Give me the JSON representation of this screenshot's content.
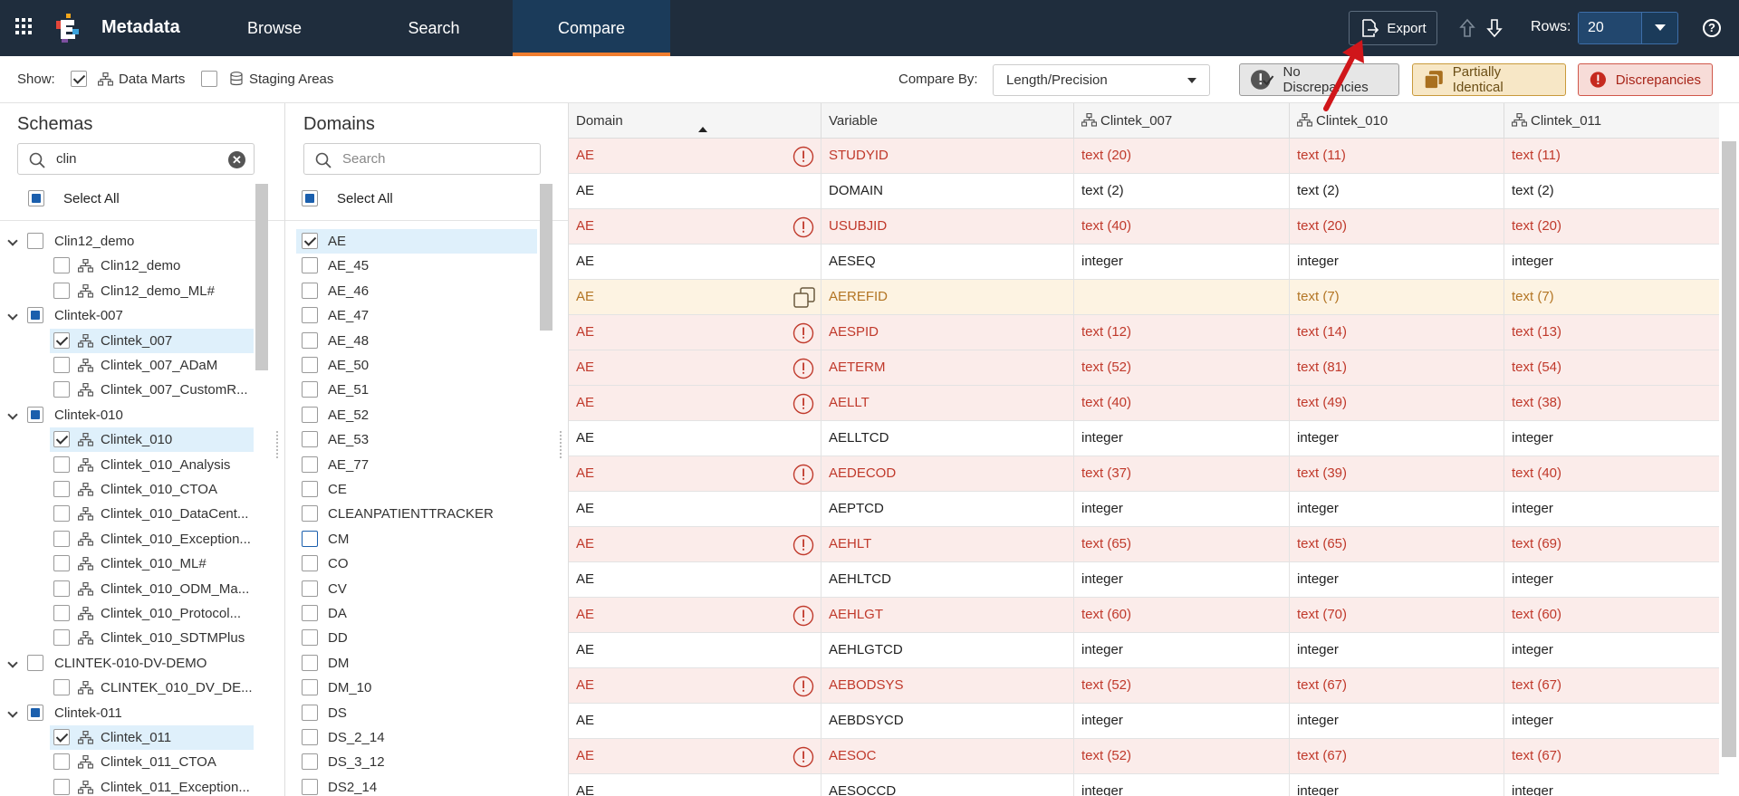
{
  "topbar": {
    "brand": "Metadata",
    "tabs": [
      {
        "label": "Browse"
      },
      {
        "label": "Search"
      },
      {
        "label": "Compare"
      }
    ],
    "export_label": "Export",
    "rows_label": "Rows:",
    "rows_value": "20",
    "help_label": "?"
  },
  "filterbar": {
    "show_label": "Show:",
    "data_marts_label": "Data Marts",
    "data_marts_checked": true,
    "staging_label": "Staging Areas",
    "staging_checked": false,
    "compare_by_label": "Compare By:",
    "compare_by_value": "Length/Precision",
    "legend": {
      "none": "No Discrepancies",
      "partial": "Partially Identical",
      "disc": "Discrepancies"
    },
    "colors": {
      "discrepancy": "#c0392b",
      "partial": "#b37524",
      "partial_bg": "#fdf3e2",
      "discrepancy_bg": "#fbecea"
    }
  },
  "schemas": {
    "title": "Schemas",
    "search_value": "clin",
    "select_all": "Select All",
    "items": [
      {
        "label": "Clin12_demo",
        "level": 0,
        "type": "group",
        "state": "none"
      },
      {
        "label": "Clin12_demo",
        "level": 1,
        "type": "schema",
        "state": "none"
      },
      {
        "label": "Clin12_demo_ML#",
        "level": 1,
        "type": "schema",
        "state": "none"
      },
      {
        "label": "Clintek-007",
        "level": 0,
        "type": "group",
        "state": "partial"
      },
      {
        "label": "Clintek_007",
        "level": 1,
        "type": "schema",
        "state": "checked"
      },
      {
        "label": "Clintek_007_ADaM",
        "level": 1,
        "type": "schema",
        "state": "none"
      },
      {
        "label": "Clintek_007_CustomR...",
        "level": 1,
        "type": "schema",
        "state": "none"
      },
      {
        "label": "Clintek-010",
        "level": 0,
        "type": "group",
        "state": "partial"
      },
      {
        "label": "Clintek_010",
        "level": 1,
        "type": "schema",
        "state": "checked"
      },
      {
        "label": "Clintek_010_Analysis",
        "level": 1,
        "type": "schema",
        "state": "none"
      },
      {
        "label": "Clintek_010_CTOA",
        "level": 1,
        "type": "schema",
        "state": "none"
      },
      {
        "label": "Clintek_010_DataCent...",
        "level": 1,
        "type": "schema",
        "state": "none"
      },
      {
        "label": "Clintek_010_Exception...",
        "level": 1,
        "type": "schema",
        "state": "none"
      },
      {
        "label": "Clintek_010_ML#",
        "level": 1,
        "type": "schema",
        "state": "none"
      },
      {
        "label": "Clintek_010_ODM_Ma...",
        "level": 1,
        "type": "schema",
        "state": "none"
      },
      {
        "label": "Clintek_010_Protocol...",
        "level": 1,
        "type": "schema",
        "state": "none"
      },
      {
        "label": "Clintek_010_SDTMPlus",
        "level": 1,
        "type": "schema",
        "state": "none"
      },
      {
        "label": "CLINTEK-010-DV-DEMO",
        "level": 0,
        "type": "group",
        "state": "none"
      },
      {
        "label": "CLINTEK_010_DV_DE...",
        "level": 1,
        "type": "schema",
        "state": "none"
      },
      {
        "label": "Clintek-011",
        "level": 0,
        "type": "group",
        "state": "partial"
      },
      {
        "label": "Clintek_011",
        "level": 1,
        "type": "schema",
        "state": "checked"
      },
      {
        "label": "Clintek_011_CTOA",
        "level": 1,
        "type": "schema",
        "state": "none"
      },
      {
        "label": "Clintek_011_Exception...",
        "level": 1,
        "type": "schema",
        "state": "none"
      }
    ]
  },
  "domains": {
    "title": "Domains",
    "search_placeholder": "Search",
    "select_all": "Select All",
    "items": [
      {
        "label": "AE",
        "checked": true
      },
      {
        "label": "AE_45",
        "checked": false
      },
      {
        "label": "AE_46",
        "checked": false
      },
      {
        "label": "AE_47",
        "checked": false
      },
      {
        "label": "AE_48",
        "checked": false
      },
      {
        "label": "AE_50",
        "checked": false
      },
      {
        "label": "AE_51",
        "checked": false
      },
      {
        "label": "AE_52",
        "checked": false
      },
      {
        "label": "AE_53",
        "checked": false
      },
      {
        "label": "AE_77",
        "checked": false
      },
      {
        "label": "CE",
        "checked": false
      },
      {
        "label": "CLEANPATIENTTRACKER",
        "checked": false
      },
      {
        "label": "CM",
        "checked": false
      },
      {
        "label": "CO",
        "checked": false
      },
      {
        "label": "CV",
        "checked": false
      },
      {
        "label": "DA",
        "checked": false
      },
      {
        "label": "DD",
        "checked": false
      },
      {
        "label": "DM",
        "checked": false
      },
      {
        "label": "DM_10",
        "checked": false
      },
      {
        "label": "DS",
        "checked": false
      },
      {
        "label": "DS_2_14",
        "checked": false
      },
      {
        "label": "DS_3_12",
        "checked": false
      },
      {
        "label": "DS2_14",
        "checked": false
      }
    ]
  },
  "grid": {
    "columns": [
      "Domain",
      "Variable",
      "Clintek_007",
      "Clintek_010",
      "Clintek_011"
    ],
    "rows": [
      {
        "domain": "AE",
        "variable": "STUDYID",
        "status": "disc",
        "c007": "text (20)",
        "c010": "text (11)",
        "c011": "text (11)"
      },
      {
        "domain": "AE",
        "variable": "DOMAIN",
        "status": "none",
        "c007": "text (2)",
        "c010": "text (2)",
        "c011": "text (2)"
      },
      {
        "domain": "AE",
        "variable": "USUBJID",
        "status": "disc",
        "c007": "text (40)",
        "c010": "text (20)",
        "c011": "text (20)"
      },
      {
        "domain": "AE",
        "variable": "AESEQ",
        "status": "none",
        "c007": "integer",
        "c010": "integer",
        "c011": "integer"
      },
      {
        "domain": "AE",
        "variable": "AEREFID",
        "status": "partial",
        "c007": "",
        "c010": "text (7)",
        "c011": "text (7)"
      },
      {
        "domain": "AE",
        "variable": "AESPID",
        "status": "disc",
        "c007": "text (12)",
        "c010": "text (14)",
        "c011": "text (13)"
      },
      {
        "domain": "AE",
        "variable": "AETERM",
        "status": "disc",
        "c007": "text (52)",
        "c010": "text (81)",
        "c011": "text (54)"
      },
      {
        "domain": "AE",
        "variable": "AELLT",
        "status": "disc",
        "c007": "text (40)",
        "c010": "text (49)",
        "c011": "text (38)"
      },
      {
        "domain": "AE",
        "variable": "AELLTCD",
        "status": "none",
        "c007": "integer",
        "c010": "integer",
        "c011": "integer"
      },
      {
        "domain": "AE",
        "variable": "AEDECOD",
        "status": "disc",
        "c007": "text (37)",
        "c010": "text (39)",
        "c011": "text (40)"
      },
      {
        "domain": "AE",
        "variable": "AEPTCD",
        "status": "none",
        "c007": "integer",
        "c010": "integer",
        "c011": "integer"
      },
      {
        "domain": "AE",
        "variable": "AEHLT",
        "status": "disc",
        "c007": "text (65)",
        "c010": "text (65)",
        "c011": "text (69)"
      },
      {
        "domain": "AE",
        "variable": "AEHLTCD",
        "status": "none",
        "c007": "integer",
        "c010": "integer",
        "c011": "integer"
      },
      {
        "domain": "AE",
        "variable": "AEHLGT",
        "status": "disc",
        "c007": "text (60)",
        "c010": "text (70)",
        "c011": "text (60)"
      },
      {
        "domain": "AE",
        "variable": "AEHLGTCD",
        "status": "none",
        "c007": "integer",
        "c010": "integer",
        "c011": "integer"
      },
      {
        "domain": "AE",
        "variable": "AEBODSYS",
        "status": "disc",
        "c007": "text (52)",
        "c010": "text (67)",
        "c011": "text (67)"
      },
      {
        "domain": "AE",
        "variable": "AEBDSYCD",
        "status": "none",
        "c007": "integer",
        "c010": "integer",
        "c011": "integer"
      },
      {
        "domain": "AE",
        "variable": "AESOC",
        "status": "disc",
        "c007": "text (52)",
        "c010": "text (67)",
        "c011": "text (67)"
      },
      {
        "domain": "AE",
        "variable": "AESOCCD",
        "status": "none",
        "c007": "integer",
        "c010": "integer",
        "c011": "integer"
      }
    ]
  }
}
